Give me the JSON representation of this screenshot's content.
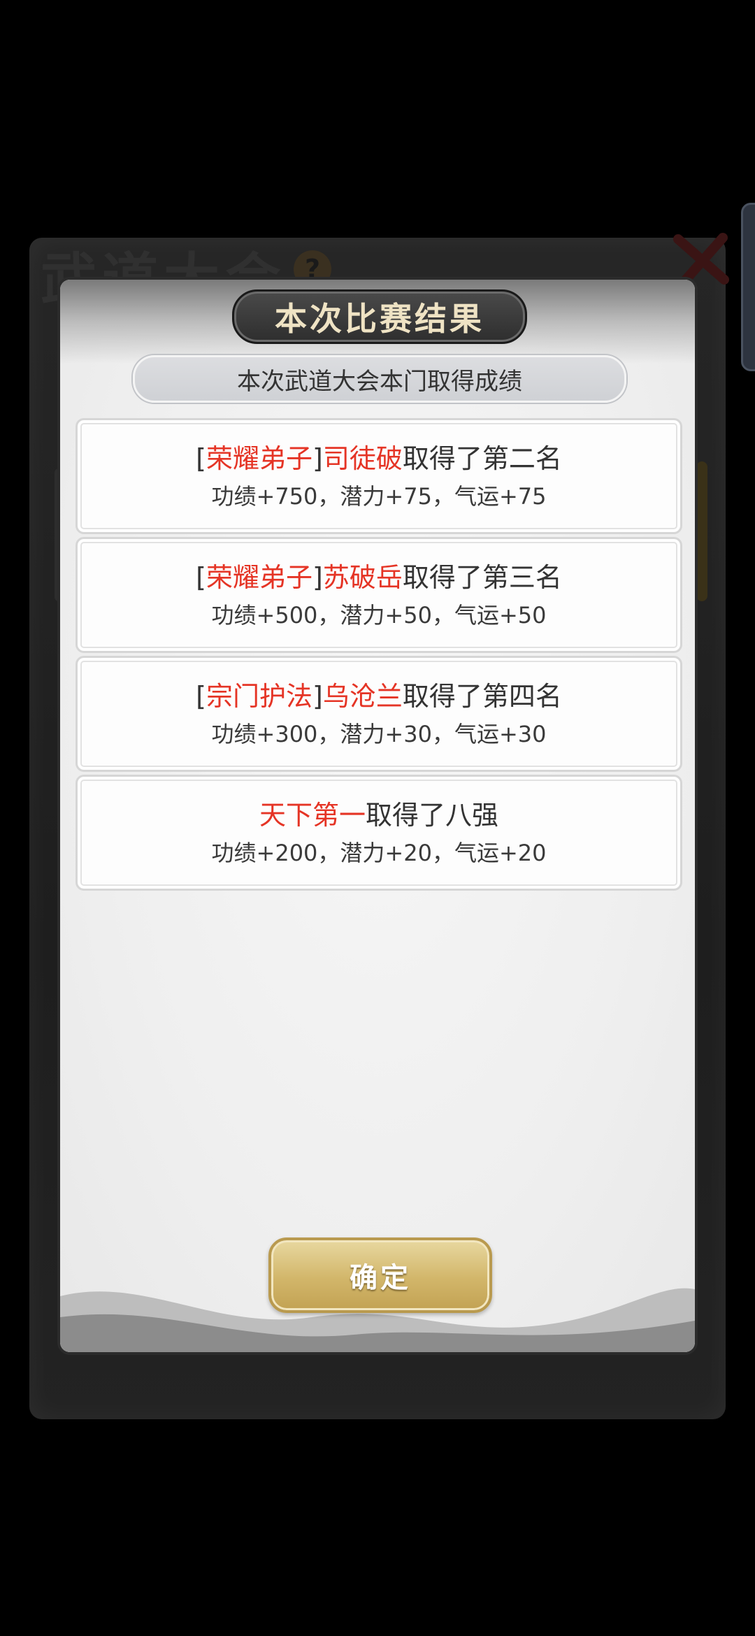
{
  "background": {
    "title": "武道大会",
    "help_glyph": "?"
  },
  "modal": {
    "title": "本次比赛结果",
    "subtitle": "本次武道大会本门取得成绩",
    "results": [
      {
        "open_bracket": "[",
        "rank_title": "荣耀弟子",
        "close_bracket": "]",
        "name": "司徒破",
        "result_text": "取得了第二名",
        "rewards": "功绩+750，潜力+75，气运+75"
      },
      {
        "open_bracket": "[",
        "rank_title": "荣耀弟子",
        "close_bracket": "]",
        "name": "苏破岳",
        "result_text": "取得了第三名",
        "rewards": "功绩+500，潜力+50，气运+50"
      },
      {
        "open_bracket": "[",
        "rank_title": "宗门护法",
        "close_bracket": "]",
        "name": "乌沧兰",
        "result_text": "取得了第四名",
        "rewards": "功绩+300，潜力+30，气运+30"
      },
      {
        "name": "天下第一",
        "result_text": "取得了八强",
        "rewards": "功绩+200，潜力+20，气运+20"
      }
    ],
    "confirm_label": "确定"
  },
  "colors": {
    "highlight_red": "#e53425",
    "title_text": "#efe3c4",
    "button_gold": "#d2b66a"
  }
}
